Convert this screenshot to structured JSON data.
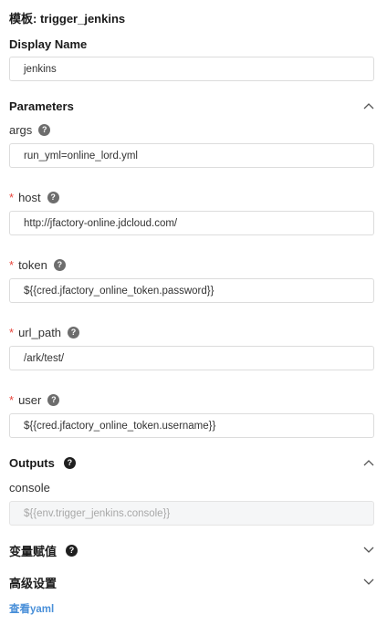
{
  "template_title": "模板: trigger_jenkins",
  "display_name": {
    "label": "Display Name",
    "value": "jenkins"
  },
  "parameters": {
    "title": "Parameters",
    "expanded": true,
    "fields": [
      {
        "label": "args",
        "required": false,
        "value": "run_yml=online_lord.yml"
      },
      {
        "label": "host",
        "required": true,
        "value": "http://jfactory-online.jdcloud.com/"
      },
      {
        "label": "token",
        "required": true,
        "value": "${{cred.jfactory_online_token.password}}"
      },
      {
        "label": "url_path",
        "required": true,
        "value": "/ark/test/"
      },
      {
        "label": "user",
        "required": true,
        "value": "${{cred.jfactory_online_token.username}}"
      }
    ]
  },
  "outputs": {
    "title": "Outputs",
    "expanded": true,
    "field_label": "console",
    "field_value": "${{env.trigger_jenkins.console}}"
  },
  "variable_assign": {
    "title": "变量赋值",
    "expanded": false
  },
  "advanced": {
    "title": "高级设置",
    "expanded": false
  },
  "view_yaml_link": "查看yaml",
  "required_mark": "*",
  "help_glyph": "?",
  "colors": {
    "required": "#e8453c",
    "link": "#4a90d9",
    "disabled_bg": "#f5f6f7"
  }
}
